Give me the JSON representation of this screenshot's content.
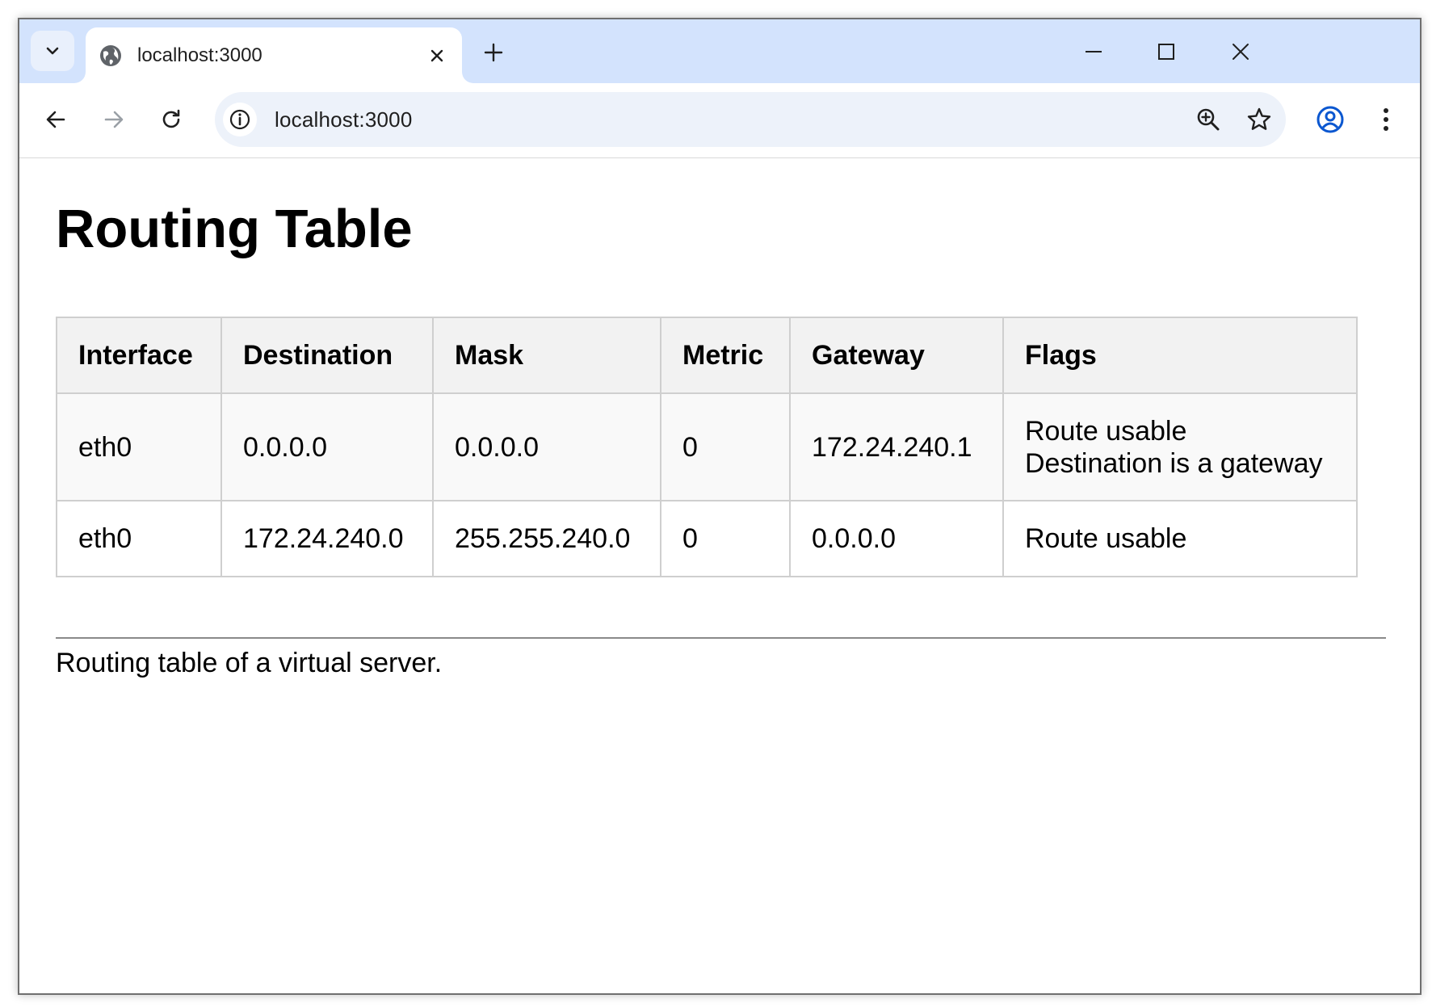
{
  "browser": {
    "tab": {
      "title": "localhost:3000",
      "favicon": "globe-icon",
      "close": "close-icon"
    },
    "new_tab": "plus-icon",
    "window_controls": [
      "minimize-icon",
      "maximize-icon",
      "close-icon"
    ],
    "toolbar": {
      "back": "back-arrow-icon",
      "forward": "forward-arrow-icon",
      "reload": "reload-icon",
      "site_info": "info-icon",
      "url": "localhost:3000",
      "zoom": "zoom-icon",
      "bookmark": "star-icon",
      "profile": "profile-icon",
      "menu": "kebab-menu-icon"
    },
    "colors": {
      "tabstrip": "#d3e3fd",
      "omnibox": "#edf2fa",
      "profile_accent": "#0b57d0"
    }
  },
  "page": {
    "title": "Routing Table",
    "table": {
      "headers": [
        "Interface",
        "Destination",
        "Mask",
        "Metric",
        "Gateway",
        "Flags"
      ],
      "rows": [
        {
          "interface": "eth0",
          "destination": "0.0.0.0",
          "mask": "0.0.0.0",
          "metric": "0",
          "gateway": "172.24.240.1",
          "flags": [
            "Route usable",
            "Destination is a gateway"
          ]
        },
        {
          "interface": "eth0",
          "destination": "172.24.240.0",
          "mask": "255.255.240.0",
          "metric": "0",
          "gateway": "0.0.0.0",
          "flags": [
            "Route usable"
          ]
        }
      ]
    },
    "caption": "Routing table of a virtual server."
  }
}
